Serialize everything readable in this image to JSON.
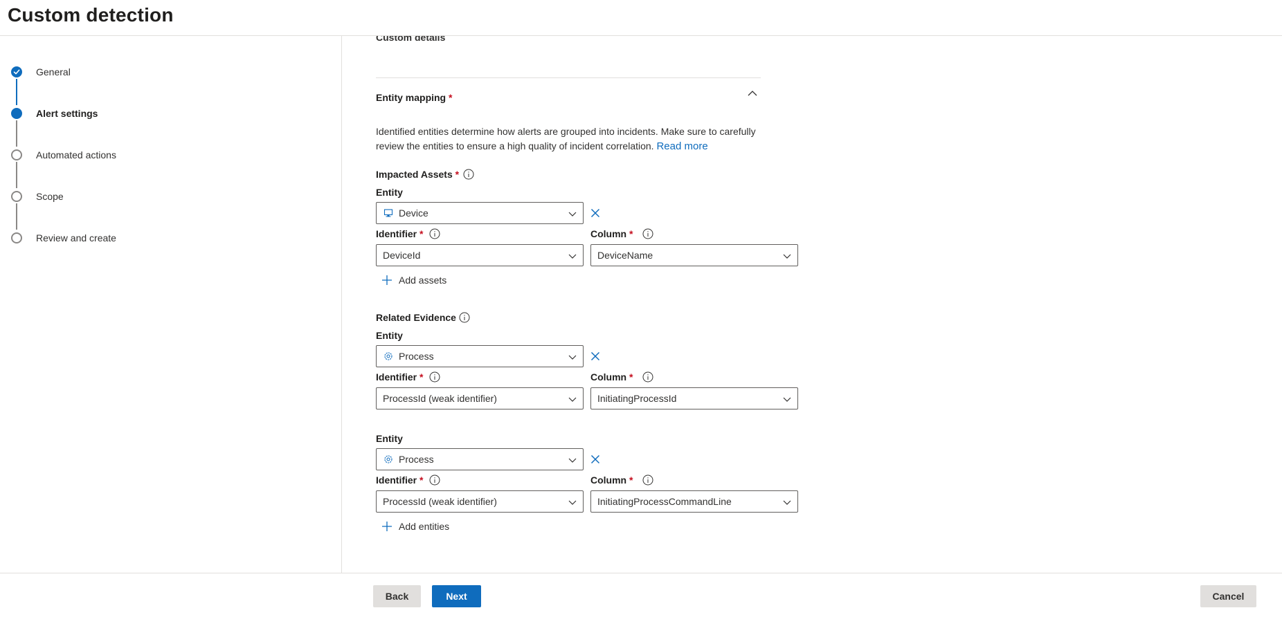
{
  "page": {
    "title": "Custom detection"
  },
  "steps": [
    {
      "label": "General",
      "state": "done"
    },
    {
      "label": "Alert settings",
      "state": "current"
    },
    {
      "label": "Automated actions",
      "state": "pending"
    },
    {
      "label": "Scope",
      "state": "pending"
    },
    {
      "label": "Review and create",
      "state": "pending"
    }
  ],
  "main": {
    "clipped_heading": "Custom details",
    "entity_mapping": {
      "title": "Entity mapping",
      "required_mark": "*",
      "description": "Identified entities determine how alerts are grouped into incidents. Make sure to carefully review the entities to ensure a high quality of incident correlation.",
      "read_more": "Read more"
    },
    "impacted_assets": {
      "title": "Impacted Assets",
      "required_mark": "*",
      "entity_label": "Entity",
      "entity_value": "Device",
      "entity_icon": "monitor-icon",
      "identifier_label": "Identifier",
      "identifier_value": "DeviceId",
      "column_label": "Column",
      "column_value": "DeviceName",
      "add_label": "Add assets"
    },
    "related_evidence": {
      "title": "Related Evidence",
      "items": [
        {
          "entity_label": "Entity",
          "entity_value": "Process",
          "entity_icon": "gear-icon",
          "identifier_label": "Identifier",
          "identifier_value": "ProcessId (weak identifier)",
          "column_label": "Column",
          "column_value": "InitiatingProcessId"
        },
        {
          "entity_label": "Entity",
          "entity_value": "Process",
          "entity_icon": "gear-icon",
          "identifier_label": "Identifier",
          "identifier_value": "ProcessId (weak identifier)",
          "column_label": "Column",
          "column_value": "InitiatingProcessCommandLine"
        }
      ],
      "add_label": "Add entities"
    },
    "required_mark": "*"
  },
  "footer": {
    "back": "Back",
    "next": "Next",
    "cancel": "Cancel"
  },
  "colors": {
    "accent": "#0f6cbd",
    "required": "#c50f1f",
    "border": "#605e5c",
    "divider": "#e1dfdd"
  }
}
